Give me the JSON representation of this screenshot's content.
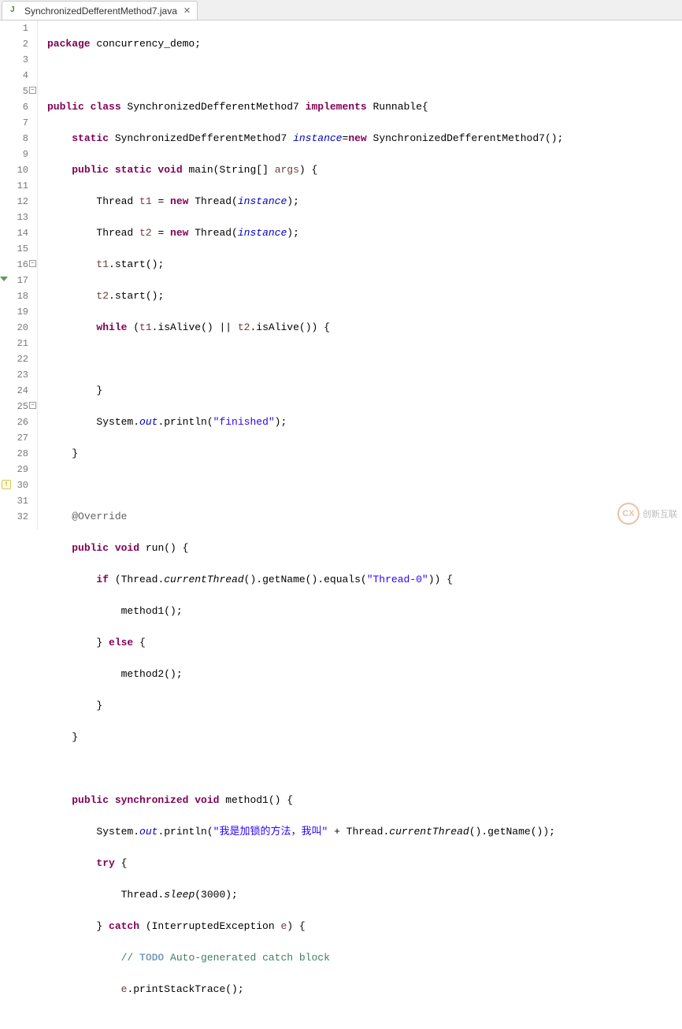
{
  "tab": {
    "filename": "SynchronizedDefferentMethod7.java",
    "close": "✕"
  },
  "gutter": {
    "lines": [
      "1",
      "2",
      "3",
      "4",
      "5",
      "6",
      "7",
      "8",
      "9",
      "10",
      "11",
      "12",
      "13",
      "14",
      "15",
      "16",
      "17",
      "18",
      "19",
      "20",
      "21",
      "22",
      "23",
      "24",
      "25",
      "26",
      "27",
      "28",
      "29",
      "30",
      "31",
      "32"
    ],
    "fold_at": [
      5,
      16,
      25
    ],
    "override_at": [
      17
    ],
    "warn_at": [
      30
    ]
  },
  "code": {
    "l1": {
      "a": "package",
      "b": " concurrency_demo;"
    },
    "l3": {
      "a": "public class",
      "b": " SynchronizedDefferentMethod7 ",
      "c": "implements",
      "d": " Runnable{"
    },
    "l4": {
      "a": "    ",
      "b": "static",
      "c": " SynchronizedDefferentMethod7 ",
      "d": "instance",
      "e": "=",
      "f": "new",
      "g": " SynchronizedDefferentMethod7();"
    },
    "l5": {
      "a": "    ",
      "b": "public static void",
      "c": " main(String[] ",
      "d": "args",
      "e": ") {"
    },
    "l6": {
      "a": "        Thread ",
      "b": "t1",
      "c": " = ",
      "d": "new",
      "e": " Thread(",
      "f": "instance",
      "g": ");"
    },
    "l7": {
      "a": "        Thread ",
      "b": "t2",
      "c": " = ",
      "d": "new",
      "e": " Thread(",
      "f": "instance",
      "g": ");"
    },
    "l8": {
      "a": "        ",
      "b": "t1",
      "c": ".start();"
    },
    "l9": {
      "a": "        ",
      "b": "t2",
      "c": ".start();"
    },
    "l10": {
      "a": "        ",
      "b": "while",
      "c": " (",
      "d": "t1",
      "e": ".isAlive() || ",
      "f": "t2",
      "g": ".isAlive()) {"
    },
    "l12": {
      "a": "        }"
    },
    "l13": {
      "a": "        System.",
      "b": "out",
      "c": ".println(",
      "d": "\"finished\"",
      "e": ");"
    },
    "l14": {
      "a": "    }"
    },
    "l16": {
      "a": "    ",
      "b": "@Override"
    },
    "l17": {
      "a": "    ",
      "b": "public void",
      "c": " run() {"
    },
    "l18": {
      "a": "        ",
      "b": "if",
      "c": " (Thread.",
      "d": "currentThread",
      "e": "().getName().equals(",
      "f": "\"Thread-0\"",
      "g": ")) {"
    },
    "l19": {
      "a": "            method1();"
    },
    "l20": {
      "a": "        } ",
      "b": "else",
      "c": " {"
    },
    "l21": {
      "a": "            method2();"
    },
    "l22": {
      "a": "        }"
    },
    "l23": {
      "a": "    }"
    },
    "l25": {
      "a": "    ",
      "b": "public synchronized void",
      "c": " method1() {"
    },
    "l26": {
      "a": "        System.",
      "b": "out",
      "c": ".println(",
      "d": "\"我是加锁的方法，我叫\"",
      "e": " + Thread.",
      "f": "currentThread",
      "g": "().getName());"
    },
    "l27": {
      "a": "        ",
      "b": "try",
      "c": " {"
    },
    "l28": {
      "a": "            Thread.",
      "b": "sleep",
      "c": "(3000);"
    },
    "l29": {
      "a": "        } ",
      "b": "catch",
      "c": " (InterruptedException ",
      "d": "e",
      "e": ") {"
    },
    "l30": {
      "a": "            ",
      "b": "// ",
      "c": "TODO",
      "d": " Auto-generated catch block"
    },
    "l31": {
      "a": "            ",
      "b": "e",
      "c": ".printStackTrace();"
    }
  },
  "watermark": {
    "logo": "CX",
    "text": "创新互联"
  }
}
